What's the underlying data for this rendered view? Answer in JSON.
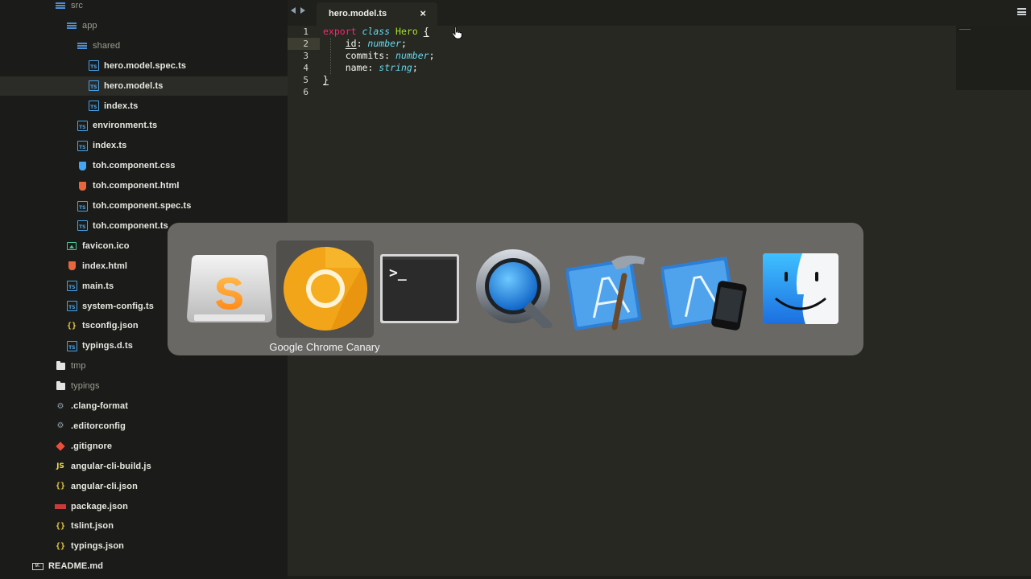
{
  "sidebar": {
    "items": [
      {
        "label": "src",
        "icon": "open-folder-icon",
        "level": 0
      },
      {
        "label": "app",
        "icon": "open-folder-icon",
        "level": 1
      },
      {
        "label": "shared",
        "icon": "open-folder-icon",
        "level": 2
      },
      {
        "label": "hero.model.spec.ts",
        "icon": "typescript-file-icon",
        "level": 3
      },
      {
        "label": "hero.model.ts",
        "icon": "typescript-file-icon",
        "level": 3,
        "selected": true
      },
      {
        "label": "index.ts",
        "icon": "typescript-file-icon",
        "level": 3
      },
      {
        "label": "environment.ts",
        "icon": "typescript-file-icon",
        "level": 2
      },
      {
        "label": "index.ts",
        "icon": "typescript-file-icon",
        "level": 2
      },
      {
        "label": "toh.component.css",
        "icon": "css-file-icon",
        "level": 2
      },
      {
        "label": "toh.component.html",
        "icon": "html-file-icon",
        "level": 2
      },
      {
        "label": "toh.component.spec.ts",
        "icon": "typescript-file-icon",
        "level": 2
      },
      {
        "label": "toh.component.ts",
        "icon": "typescript-file-icon",
        "level": 2
      },
      {
        "label": "favicon.ico",
        "icon": "image-file-icon",
        "level": 1
      },
      {
        "label": "index.html",
        "icon": "html-file-icon",
        "level": 1
      },
      {
        "label": "main.ts",
        "icon": "typescript-file-icon",
        "level": 1
      },
      {
        "label": "system-config.ts",
        "icon": "typescript-file-icon",
        "level": 1
      },
      {
        "label": "tsconfig.json",
        "icon": "json-file-icon",
        "level": 1
      },
      {
        "label": "typings.d.ts",
        "icon": "typescript-file-icon",
        "level": 1
      },
      {
        "label": "tmp",
        "icon": "folder-icon",
        "level": 0
      },
      {
        "label": "typings",
        "icon": "folder-icon",
        "level": 0
      },
      {
        "label": ".clang-format",
        "icon": "gear-icon",
        "level": 0
      },
      {
        "label": ".editorconfig",
        "icon": "gear-icon",
        "level": 0
      },
      {
        "label": ".gitignore",
        "icon": "git-icon",
        "level": 0
      },
      {
        "label": "angular-cli-build.js",
        "icon": "javascript-file-icon",
        "level": 0
      },
      {
        "label": "angular-cli.json",
        "icon": "json-file-icon",
        "level": 0
      },
      {
        "label": "package.json",
        "icon": "npm-icon",
        "level": 0
      },
      {
        "label": "tslint.json",
        "icon": "json-file-icon",
        "level": 0
      },
      {
        "label": "typings.json",
        "icon": "json-file-icon",
        "level": 0
      },
      {
        "label": "README.md",
        "icon": "markdown-file-icon",
        "level": -1
      }
    ]
  },
  "tabbar": {
    "active_tab": "hero.model.ts",
    "close_glyph": "×"
  },
  "editor": {
    "line_numbers": [
      "1",
      "2",
      "3",
      "4",
      "5",
      "6"
    ],
    "active_line": 2,
    "code": {
      "l1_export": "export",
      "l1_class": "class",
      "l1_name": "Hero",
      "l1_brace": "{",
      "l2_prop": "id",
      "l2_type": "number",
      "l3_prop": "commits",
      "l3_type": "number",
      "l4_prop": "name",
      "l4_type": "string",
      "l5_brace": "}"
    }
  },
  "app_switcher": {
    "apps": [
      {
        "name": "Sublime Text",
        "icon": "sublime-text-icon"
      },
      {
        "name": "Google Chrome Canary",
        "icon": "chrome-canary-icon",
        "selected": true
      },
      {
        "name": "Terminal",
        "icon": "terminal-icon"
      },
      {
        "name": "QuickTime Player",
        "icon": "quicktime-icon"
      },
      {
        "name": "Xcode",
        "icon": "xcode-icon"
      },
      {
        "name": "Simulator",
        "icon": "simulator-icon"
      },
      {
        "name": "Finder",
        "icon": "finder-icon"
      }
    ],
    "selected_caption": "Google Chrome Canary",
    "terminal_prompt": ">_"
  },
  "colors": {
    "keyword": "#f92672",
    "storage": "#66d9ef",
    "class_name": "#a6e22e",
    "background": "#272822",
    "sidebar": "#1b1c19"
  }
}
